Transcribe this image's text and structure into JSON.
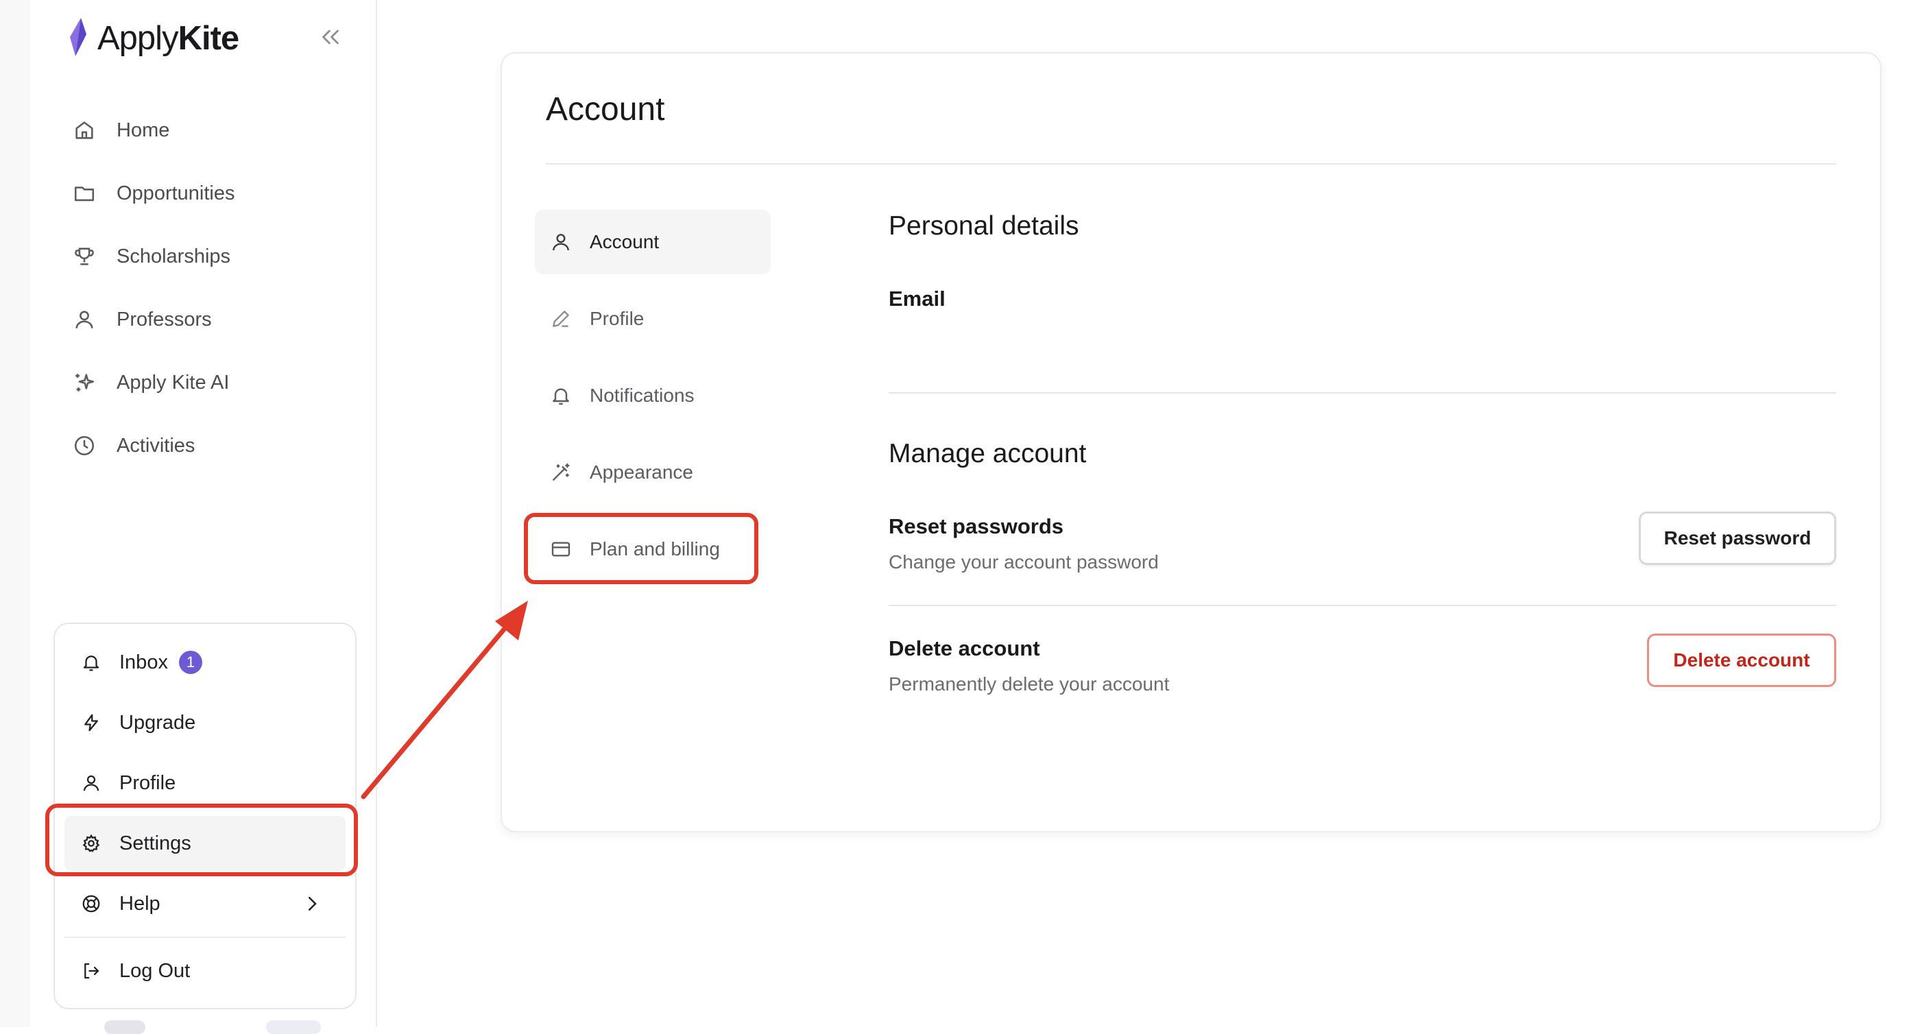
{
  "brand": {
    "name_light": "Apply",
    "name_bold": "Kite"
  },
  "sidebar": {
    "items": [
      {
        "label": "Home",
        "icon": "home-icon"
      },
      {
        "label": "Opportunities",
        "icon": "folder-icon"
      },
      {
        "label": "Scholarships",
        "icon": "trophy-icon"
      },
      {
        "label": "Professors",
        "icon": "user-icon"
      },
      {
        "label": "Apply Kite AI",
        "icon": "sparkles-icon"
      },
      {
        "label": "Activities",
        "icon": "clock-icon"
      }
    ]
  },
  "bottom_menu": {
    "inbox": {
      "label": "Inbox",
      "badge": "1"
    },
    "upgrade": {
      "label": "Upgrade"
    },
    "profile": {
      "label": "Profile"
    },
    "settings": {
      "label": "Settings"
    },
    "help": {
      "label": "Help"
    },
    "logout": {
      "label": "Log Out"
    }
  },
  "settings_page": {
    "title": "Account",
    "subnav": [
      {
        "label": "Account",
        "icon": "user-icon",
        "active": true
      },
      {
        "label": "Profile",
        "icon": "pencil-icon"
      },
      {
        "label": "Notifications",
        "icon": "bell-icon"
      },
      {
        "label": "Appearance",
        "icon": "wand-icon"
      },
      {
        "label": "Plan and billing",
        "icon": "credit-card-icon"
      }
    ],
    "personal": {
      "title": "Personal details",
      "email_label": "Email"
    },
    "manage": {
      "title": "Manage account",
      "reset": {
        "label": "Reset passwords",
        "desc": "Change your account password",
        "button": "Reset password"
      },
      "delete": {
        "label": "Delete account",
        "desc": "Permanently delete your account",
        "button": "Delete account"
      }
    }
  },
  "colors": {
    "accent": "#6d5bd6",
    "highlight": "#e03b2a",
    "danger": "#c0271a"
  }
}
